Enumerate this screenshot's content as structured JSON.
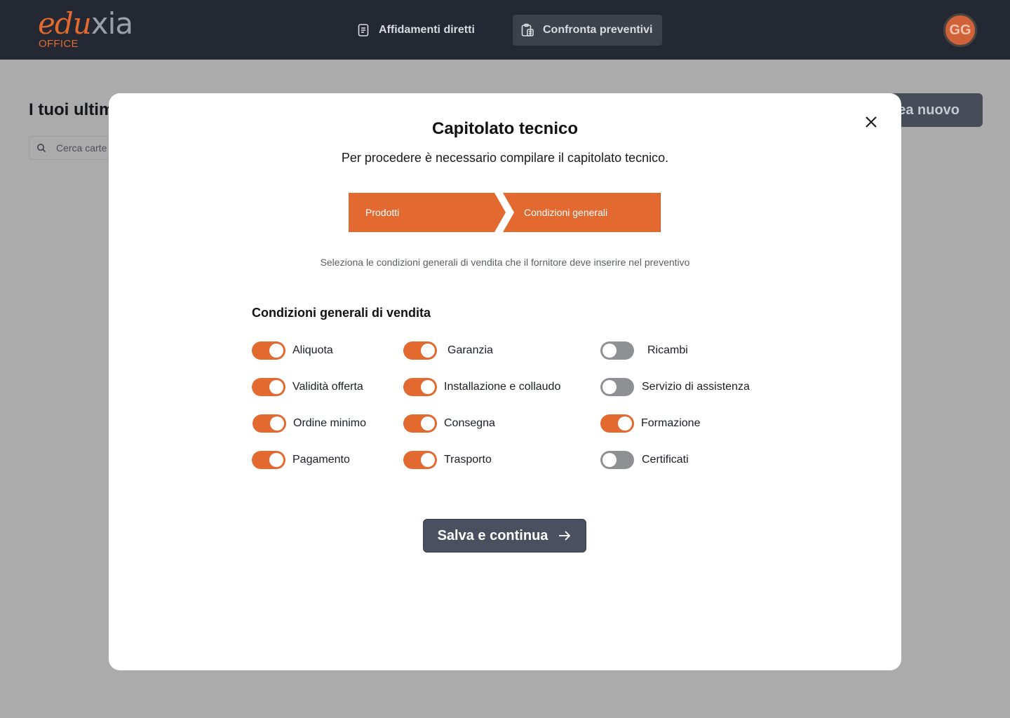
{
  "logo": {
    "brand_part1": "edu",
    "brand_part2": "xia",
    "sub": "OFFICE"
  },
  "nav": [
    {
      "label": "Affidamenti diretti",
      "icon": "document-icon",
      "active": false
    },
    {
      "label": "Confronta preventivi",
      "icon": "compare-clipboard-icon",
      "active": true
    }
  ],
  "user": {
    "initials": "GG"
  },
  "background_page": {
    "heading": "I tuoi ultim",
    "search_placeholder": "Cerca carte",
    "new_button": "ea nuovo"
  },
  "modal": {
    "title": "Capitolato tecnico",
    "subtitle": "Per procedere è necessario compilare il capitolato tecnico.",
    "steps": [
      "Prodotti",
      "Condizioni generali"
    ],
    "hint": "Seleziona le condizioni generali di vendita che il fornitore deve inserire nel preventivo",
    "section_title": "Condizioni generali di vendita",
    "conditions": [
      {
        "label": "Aliquota",
        "enabled": true
      },
      {
        "label": "Garanzia",
        "enabled": true
      },
      {
        "label": "Ricambi",
        "enabled": false
      },
      {
        "label": "Validità offerta",
        "enabled": true
      },
      {
        "label": "Installazione e collaudo",
        "enabled": true
      },
      {
        "label": "Servizio di assistenza",
        "enabled": false
      },
      {
        "label": "Ordine minimo",
        "enabled": true
      },
      {
        "label": "Consegna",
        "enabled": true
      },
      {
        "label": "Formazione",
        "enabled": true
      },
      {
        "label": "Pagamento",
        "enabled": true
      },
      {
        "label": "Trasporto",
        "enabled": true
      },
      {
        "label": "Certificati",
        "enabled": false
      }
    ],
    "save_button": "Salva e continua"
  },
  "colors": {
    "accent": "#e2692f",
    "topbar": "#242832",
    "button": "#4a5060",
    "toggle_off": "#8f9093"
  }
}
